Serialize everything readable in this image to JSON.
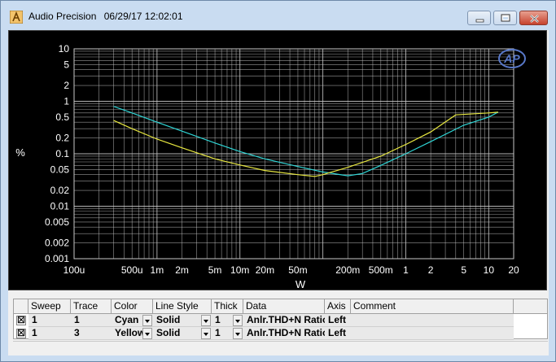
{
  "window": {
    "title": "Audio Precision",
    "datetime": "06/29/17 12:02:01",
    "buttons": [
      "minimize",
      "restore",
      "close"
    ]
  },
  "colors": {
    "plot_background": "#000000",
    "grid": "#c8c8c8",
    "cyan": "#2fd6d6",
    "yellow": "#e8e840",
    "ap_logo": "#5878c8"
  },
  "chart_data": {
    "type": "line",
    "xlabel": "W",
    "ylabel": "%",
    "xscale": "log",
    "yscale": "log",
    "xlim": [
      0.0001,
      20
    ],
    "ylim": [
      0.001,
      10
    ],
    "x_ticks": [
      "100u",
      "500u",
      "1m",
      "2m",
      "5m",
      "10m",
      "20m",
      "50m",
      "200m",
      "500m",
      "1",
      "2",
      "5",
      "10",
      "20"
    ],
    "y_ticks": [
      "10",
      "5",
      "2",
      "1",
      "0.5",
      "0.2",
      "0.1",
      "0.05",
      "0.02",
      "0.01",
      "0.005",
      "0.002",
      "0.001"
    ],
    "grid": true,
    "logo_text": "AP",
    "series": [
      {
        "name": "Anlr.THD+N Ratio",
        "color": "Cyan",
        "x": [
          0.0003,
          0.0005,
          0.001,
          0.002,
          0.005,
          0.01,
          0.02,
          0.05,
          0.1,
          0.2,
          0.3,
          0.5,
          1,
          2,
          5,
          10,
          13
        ],
        "y": [
          0.8,
          0.6,
          0.4,
          0.27,
          0.16,
          0.11,
          0.08,
          0.057,
          0.045,
          0.038,
          0.042,
          0.06,
          0.1,
          0.17,
          0.35,
          0.5,
          0.62
        ]
      },
      {
        "name": "Anlr.THD+N Ratio",
        "color": "Yellow",
        "x": [
          0.0003,
          0.0005,
          0.001,
          0.002,
          0.005,
          0.01,
          0.02,
          0.05,
          0.08,
          0.1,
          0.2,
          0.5,
          1,
          2,
          4,
          10,
          13
        ],
        "y": [
          0.43,
          0.3,
          0.19,
          0.13,
          0.08,
          0.061,
          0.048,
          0.04,
          0.037,
          0.04,
          0.055,
          0.09,
          0.15,
          0.26,
          0.55,
          0.6,
          0.62
        ]
      }
    ]
  },
  "table": {
    "headers": [
      "Sweep",
      "Trace",
      "Color",
      "Line Style",
      "Thick",
      "Data",
      "Axis",
      "Comment"
    ],
    "rows": [
      {
        "checked": "☒",
        "sweep": "1",
        "trace": "1",
        "color": "Cyan",
        "line_style": "Solid",
        "thick": "1",
        "data": "Anlr.THD+N Ratio",
        "axis": "Left",
        "comment": ""
      },
      {
        "checked": "☒",
        "sweep": "1",
        "trace": "3",
        "color": "Yellow",
        "line_style": "Solid",
        "thick": "1",
        "data": "Anlr.THD+N Ratio",
        "axis": "Left",
        "comment": ""
      }
    ]
  }
}
